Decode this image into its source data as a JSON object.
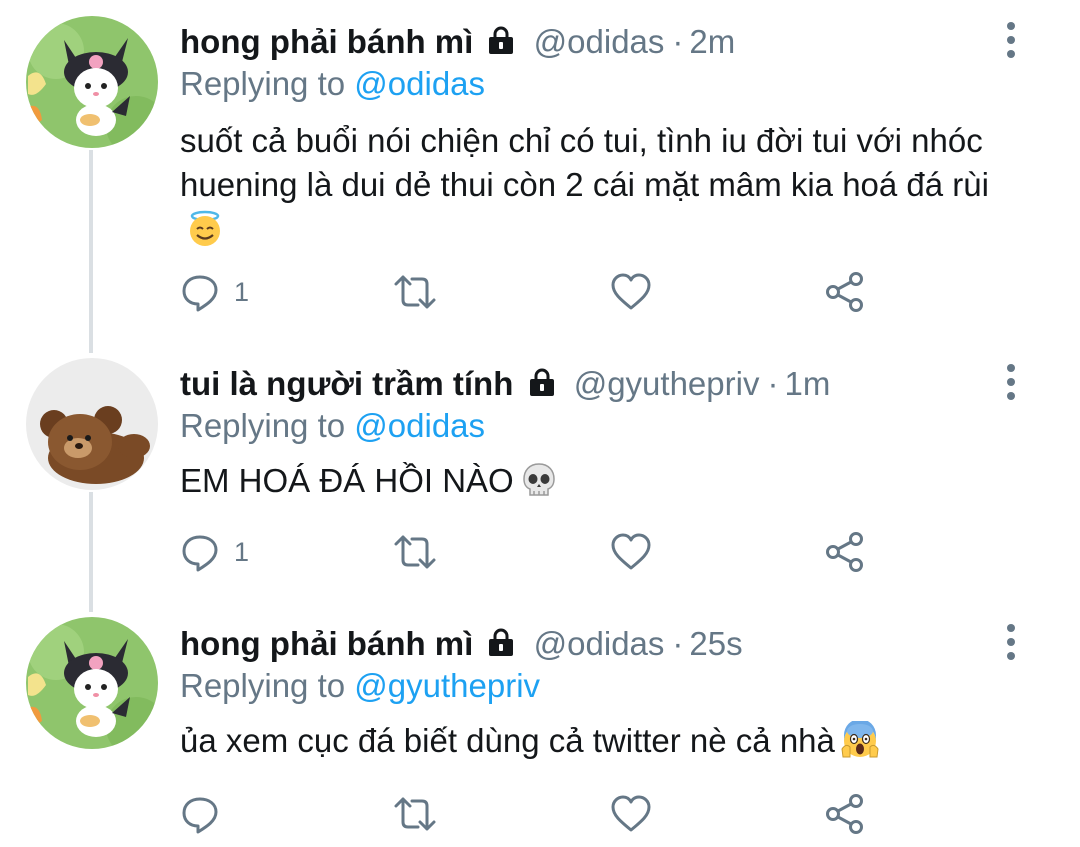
{
  "tweets": [
    {
      "display_name": "hong phải bánh mì",
      "handle": "@odidas",
      "separator": "·",
      "time": "2m",
      "replying_prefix": "Replying to",
      "replying_to": "@odidas",
      "text": "suốt cả buổi nói chiện chỉ có tui, tình iu đời tui với nhóc huening là dui dẻ thui còn 2 cái mặt mâm kia hoá đá rùi",
      "emoji": "smiling-face-with-halo",
      "reply_count": "1",
      "avatar": "kuromi-avatar"
    },
    {
      "display_name": "tui là người trầm tính",
      "handle": "@gyuthepriv",
      "separator": "·",
      "time": "1m",
      "replying_prefix": "Replying to",
      "replying_to": "@odidas",
      "text": "EM HOÁ ĐÁ HỒI NÀO",
      "emoji": "skull",
      "reply_count": "1",
      "avatar": "teddy-bear-avatar"
    },
    {
      "display_name": "hong phải bánh mì",
      "handle": "@odidas",
      "separator": "·",
      "time": "25s",
      "replying_prefix": "Replying to",
      "replying_to": "@gyuthepriv",
      "text": "ủa xem cục đá biết dùng cả twitter nè cả nhà",
      "emoji": "face-screaming-in-fear",
      "reply_count": "",
      "avatar": "kuromi-avatar"
    }
  ],
  "colors": {
    "text_primary": "#14171a",
    "text_secondary": "#657786",
    "link_blue": "#1da1f2",
    "thread_line": "#dadfe3"
  }
}
